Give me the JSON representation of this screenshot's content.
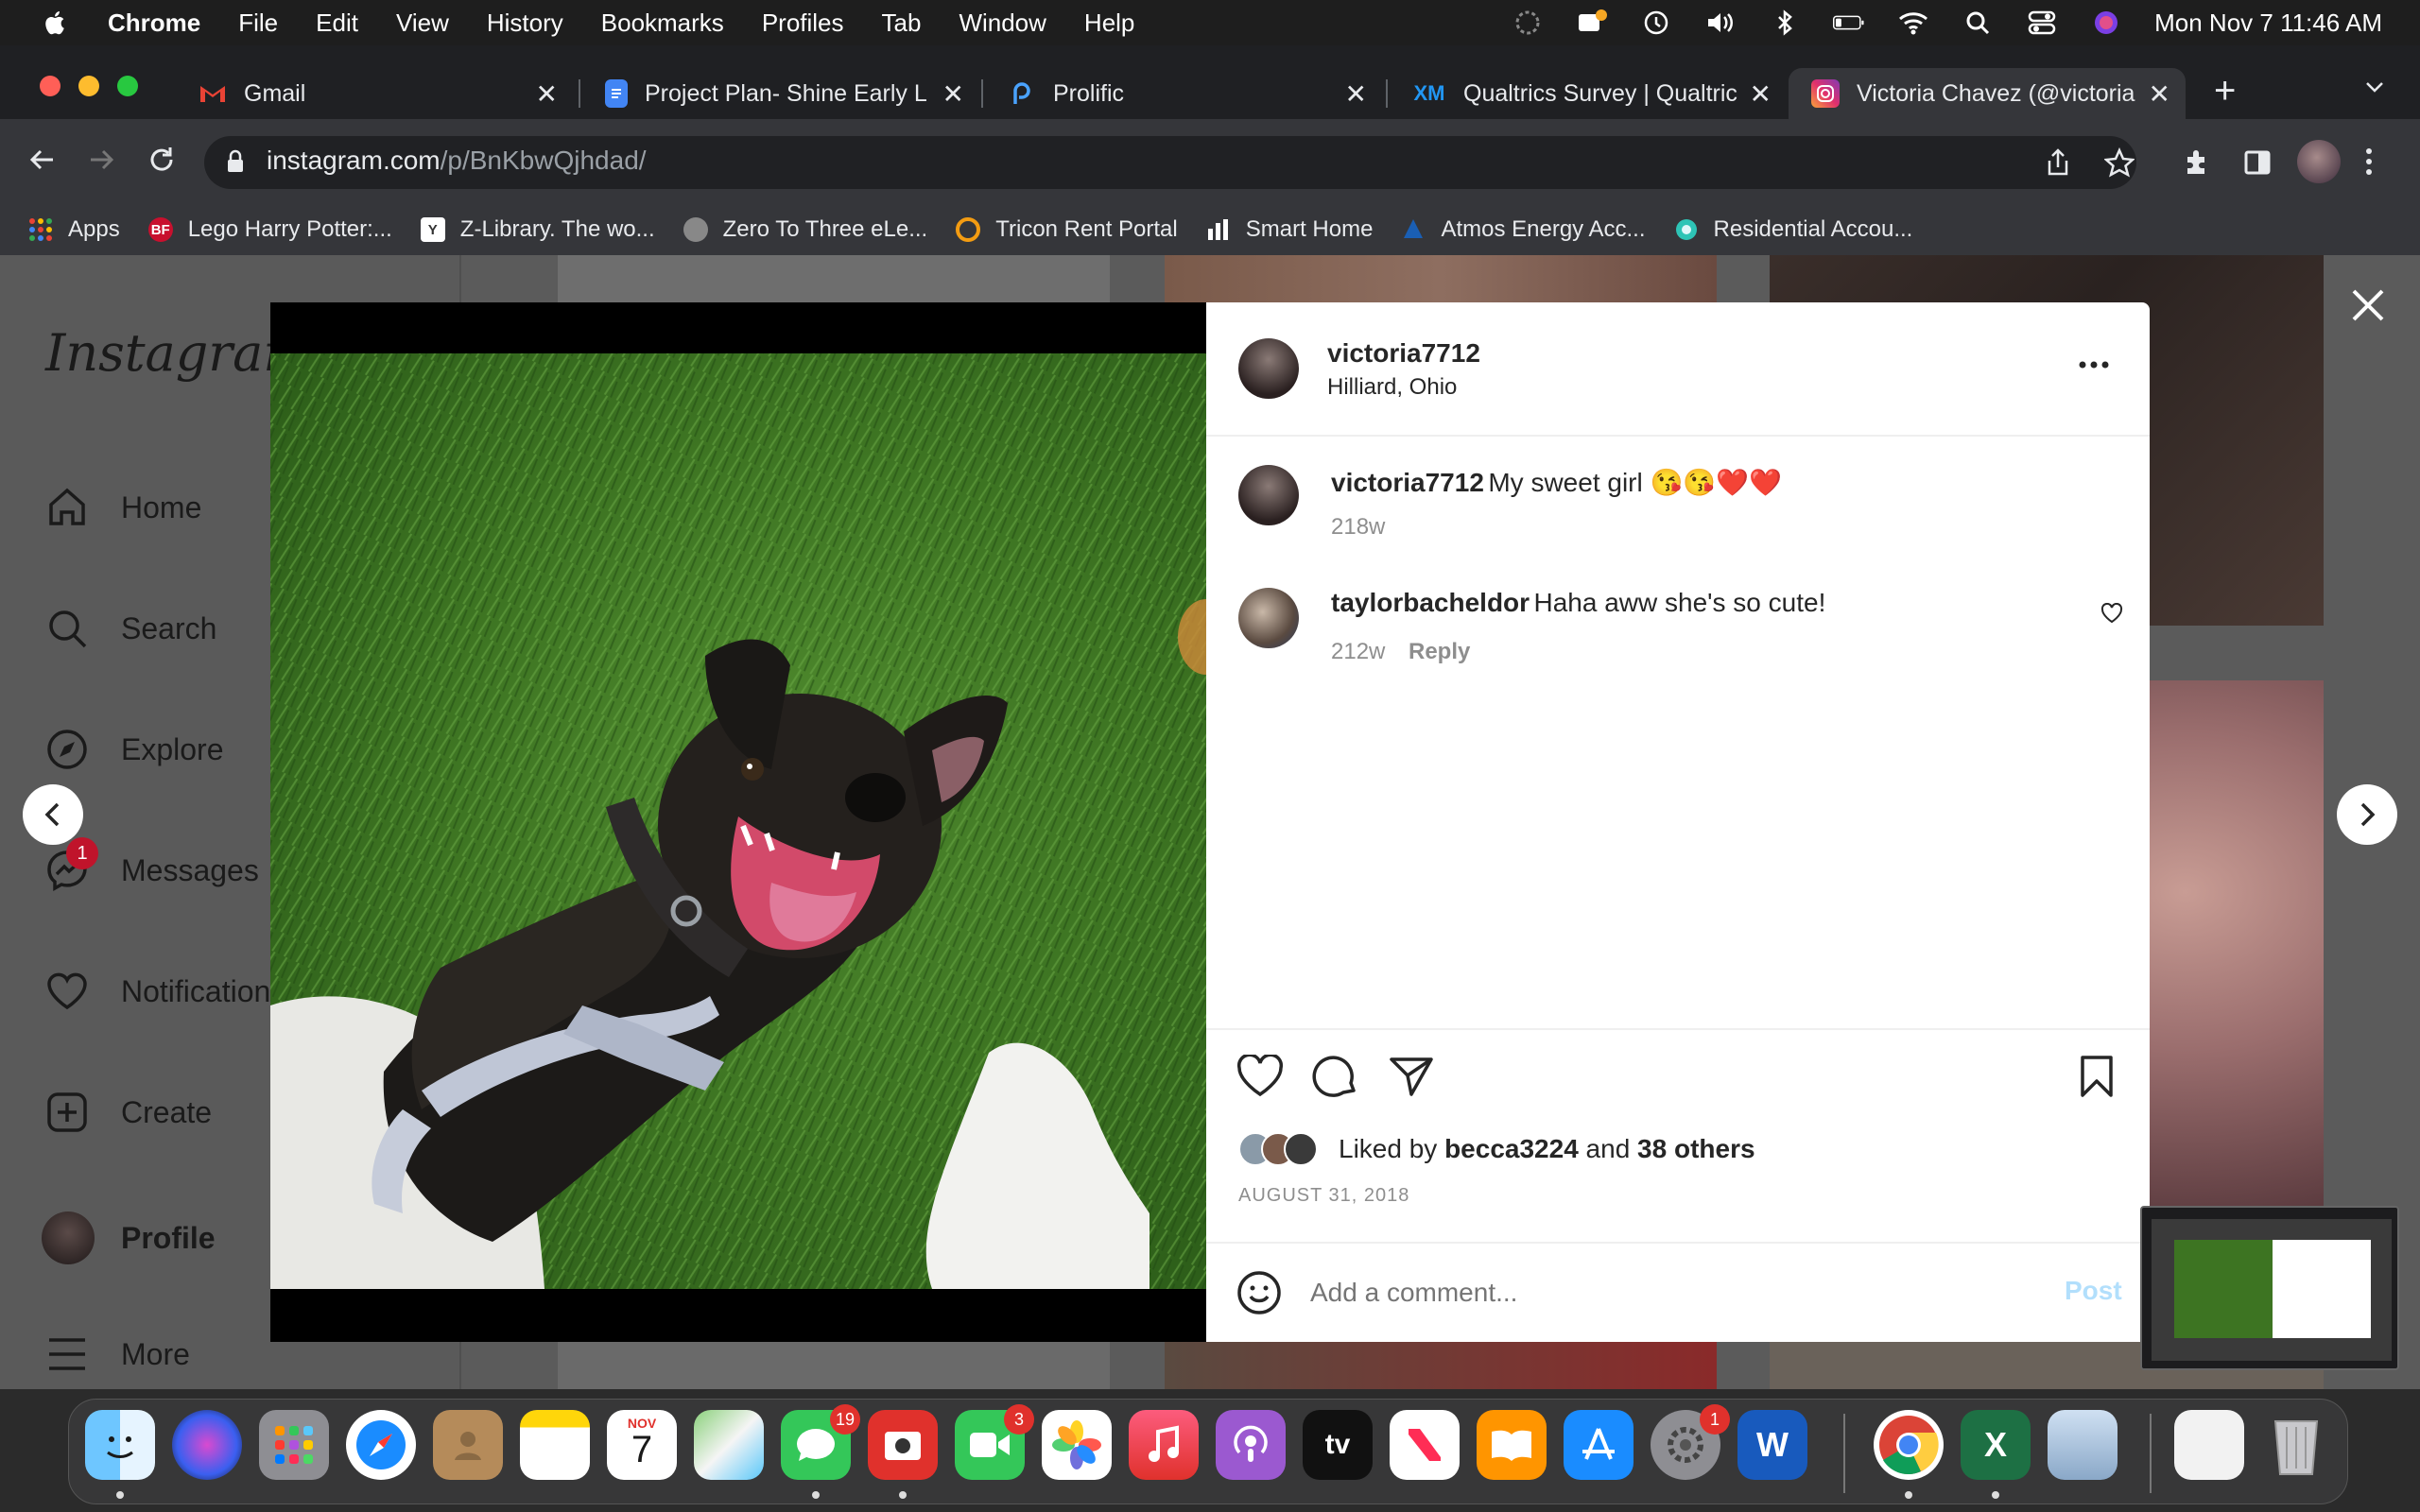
{
  "menubar": {
    "app_name": "Chrome",
    "menus": [
      "File",
      "Edit",
      "View",
      "History",
      "Bookmarks",
      "Profiles",
      "Tab",
      "Window",
      "Help"
    ],
    "datetime": "Mon Nov 7  11:46 AM"
  },
  "tabs": [
    {
      "title": "Gmail",
      "icon": "gmail-icon"
    },
    {
      "title": "Project Plan- Shine Early L",
      "icon": "docs-icon"
    },
    {
      "title": "Prolific",
      "icon": "prolific-icon"
    },
    {
      "title": "Qualtrics Survey | Qualtric",
      "icon": "qualtrics-icon"
    },
    {
      "title": "Victoria Chavez (@victoria",
      "icon": "instagram-icon",
      "active": true
    }
  ],
  "address": {
    "host": "instagram.com",
    "path": "/p/BnKbwQjhdad/"
  },
  "bookmarks": [
    "Apps",
    "Lego Harry Potter:...",
    "Z-Library. The wo...",
    "Zero To Three eLe...",
    "Tricon Rent Portal",
    "Smart Home",
    "Atmos Energy Acc...",
    "Residential Accou..."
  ],
  "sidebar": {
    "logo": "Instagram",
    "items": [
      "Home",
      "Search",
      "Explore",
      "Messages",
      "Notifications",
      "Create",
      "Profile",
      "More"
    ],
    "messages_badge": "1"
  },
  "post": {
    "author": "victoria7712",
    "location": "Hilliard, Ohio",
    "caption_author": "victoria7712",
    "caption": "My sweet girl 😘😘❤️❤️",
    "caption_age": "218w",
    "comments": [
      {
        "author": "taylorbacheldor",
        "text": "Haha aww she's so cute!",
        "age": "212w",
        "reply": "Reply"
      }
    ],
    "liked_prefix": "Liked by",
    "liked_user": "becca3224",
    "liked_and": "and",
    "liked_others": "38 others",
    "date": "AUGUST 31, 2018",
    "comment_placeholder": "Add a comment...",
    "post_button": "Post"
  },
  "dock": {
    "calendar_month": "NOV",
    "calendar_day": "7",
    "messages_badge": "19",
    "photobooth_badge": "",
    "facetime_badge": "3",
    "settings_badge": "1",
    "tv_label": "tv"
  },
  "colors": {
    "instagram_blue": "#b2dffc",
    "chrome_dark": "#35363a",
    "badge_red": "#c0142b"
  }
}
